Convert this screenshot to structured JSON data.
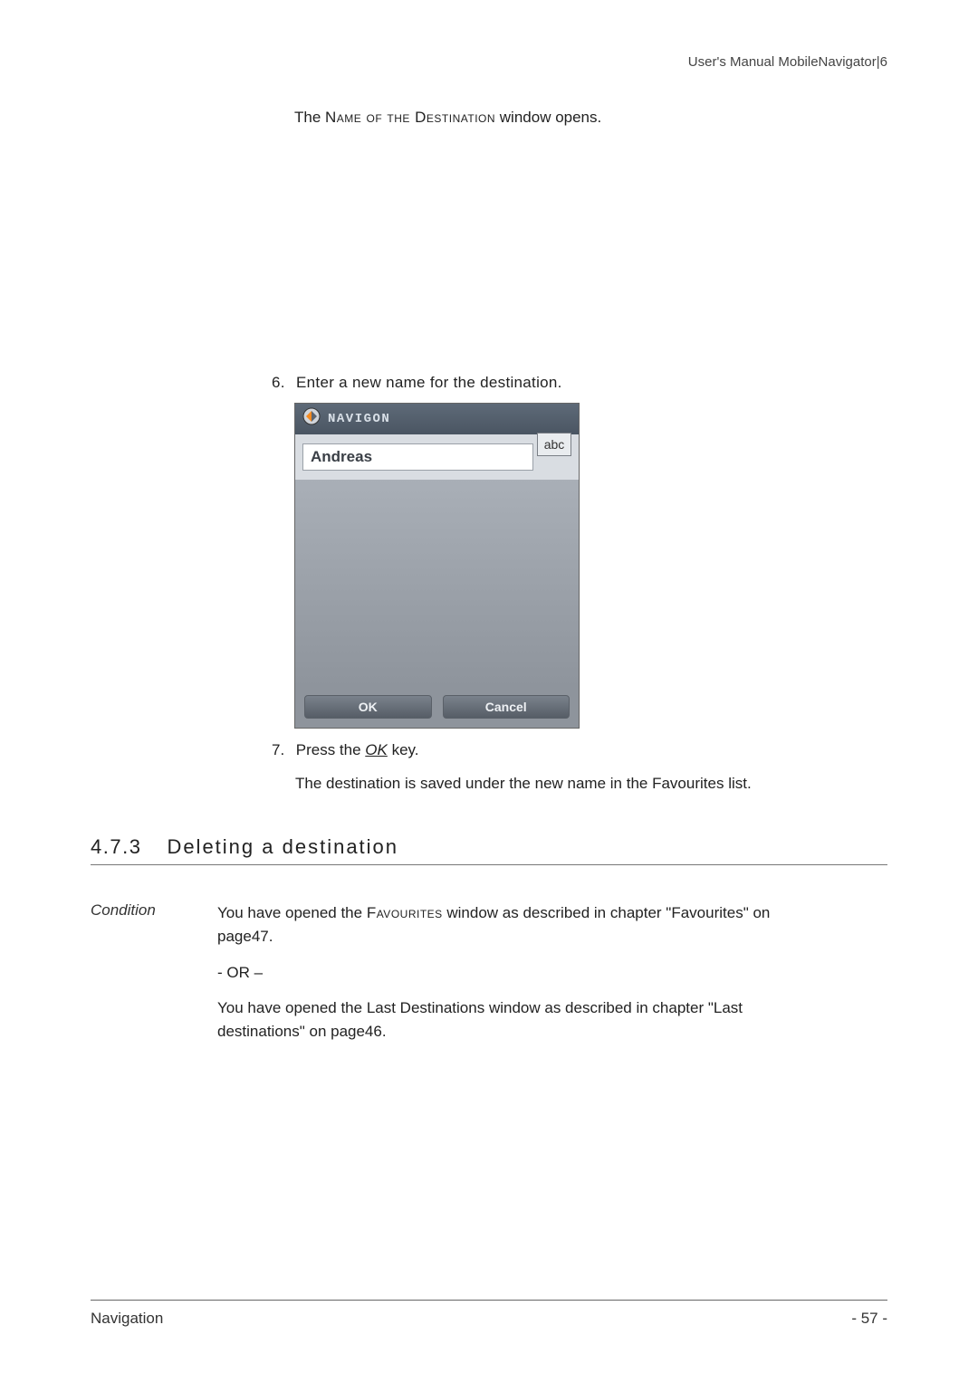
{
  "header": {
    "right": "User's Manual MobileNavigator|6"
  },
  "intro": {
    "prefix": "The ",
    "smallcaps": "Name of the Destination",
    "suffix": " window opens."
  },
  "step6": {
    "num": "6.",
    "text": "Enter a new name for the destination."
  },
  "device": {
    "brand": "NAVIGON",
    "input_value": "Andreas",
    "abc_label": "abc",
    "ok": "OK",
    "cancel": "Cancel"
  },
  "step7": {
    "num": "7.",
    "prefix": "Press the ",
    "ok": "OK",
    "suffix": " key."
  },
  "saved": {
    "line1": "The destination is saved under the new name in the ",
    "smallcaps": "Favourites",
    "line1_suffix": " list."
  },
  "section": {
    "num": "4.7.3",
    "title": "Deleting a destination"
  },
  "condition": {
    "label": "Condition",
    "c1_prefix": "You have opened the ",
    "c1_small": "Favourites",
    "c1_suffix": " window as described in chapter \"Favourites\" on page47.",
    "or": "- OR –",
    "c2_prefix": "You have opened the ",
    "c2_small": "Last Destinations",
    "c2_suffix": " window as described in chapter \"Last destinations\" on page46."
  },
  "footer": {
    "left": "Navigation",
    "right": "- 57 -"
  }
}
